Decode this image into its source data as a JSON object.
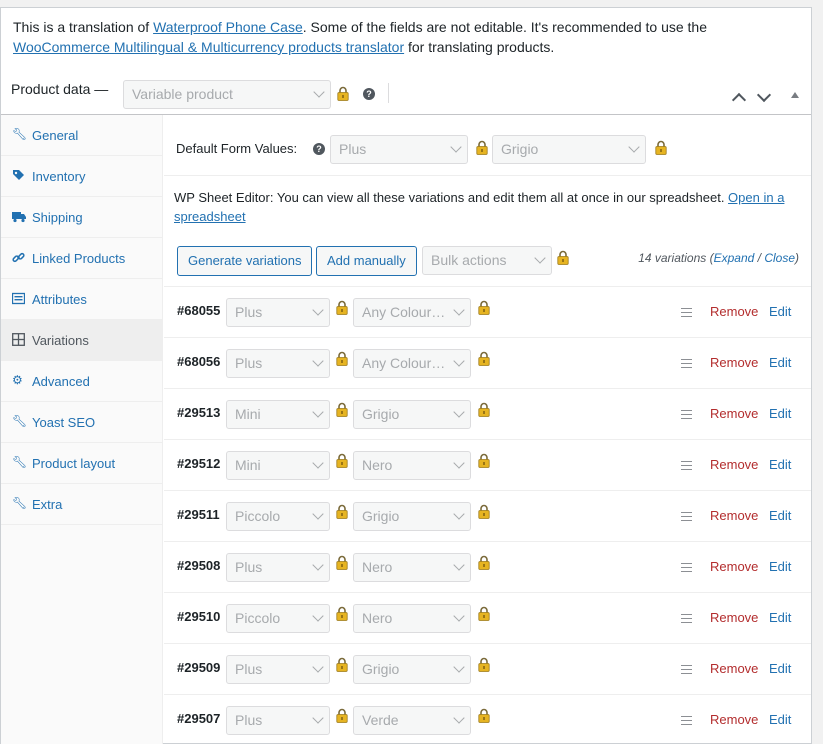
{
  "notice": {
    "prefix": "This is a translation of ",
    "product_link": "Waterproof Phone Case",
    "middle": ". Some of the fields are not editable. It's recommended to use the ",
    "translator_link": "WooCommerce Multilingual & Multicurrency products translator",
    "suffix": " for translating products."
  },
  "header": {
    "label": "Product data —",
    "product_type": "Variable product"
  },
  "sidebar": {
    "items": [
      {
        "label": "General",
        "icon": "wrench-icon"
      },
      {
        "label": "Inventory",
        "icon": "tag-icon"
      },
      {
        "label": "Shipping",
        "icon": "truck-icon"
      },
      {
        "label": "Linked Products",
        "icon": "link-icon"
      },
      {
        "label": "Attributes",
        "icon": "list-icon"
      },
      {
        "label": "Variations",
        "icon": "grid-icon",
        "active": true
      },
      {
        "label": "Advanced",
        "icon": "gear-icon"
      },
      {
        "label": "Yoast SEO",
        "icon": "wrench-icon"
      },
      {
        "label": "Product layout",
        "icon": "wrench-icon"
      },
      {
        "label": "Extra",
        "icon": "wrench-icon"
      }
    ]
  },
  "default_form": {
    "label": "Default Form Values:",
    "value1": "Plus",
    "value2": "Grigio"
  },
  "sheet_editor": {
    "title": "WP Sheet Editor:",
    "text": " You can view all these variations and edit them all at once in our spreadsheet. ",
    "link": "Open in a spreadsheet"
  },
  "actions": {
    "generate": "Generate variations",
    "add_manually": "Add manually",
    "bulk": "Bulk actions",
    "count": "14 variations",
    "expand": "Expand",
    "sep": " / ",
    "close": "Close"
  },
  "row_labels": {
    "remove": "Remove",
    "edit": "Edit"
  },
  "variations": [
    {
      "id": "#68055",
      "size": "Plus",
      "colour": "Any Colour…"
    },
    {
      "id": "#68056",
      "size": "Plus",
      "colour": "Any Colour…"
    },
    {
      "id": "#29513",
      "size": "Mini",
      "colour": "Grigio"
    },
    {
      "id": "#29512",
      "size": "Mini",
      "colour": "Nero"
    },
    {
      "id": "#29511",
      "size": "Piccolo",
      "colour": "Grigio"
    },
    {
      "id": "#29508",
      "size": "Plus",
      "colour": "Nero"
    },
    {
      "id": "#29510",
      "size": "Piccolo",
      "colour": "Nero"
    },
    {
      "id": "#29509",
      "size": "Plus",
      "colour": "Grigio"
    },
    {
      "id": "#29507",
      "size": "Plus",
      "colour": "Verde"
    }
  ],
  "colors": {
    "link": "#2271b1",
    "remove": "#b32d2e",
    "lock": "#d4a017"
  }
}
